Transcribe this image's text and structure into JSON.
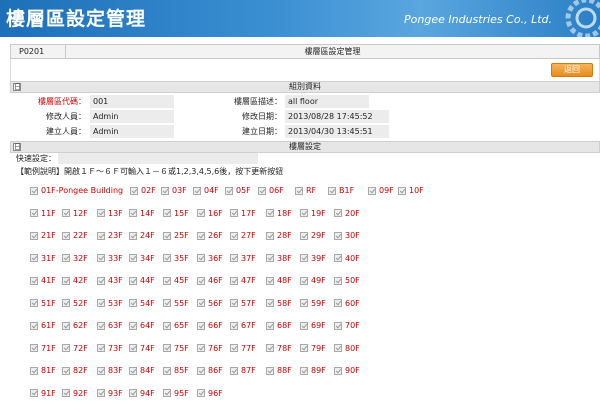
{
  "header": {
    "title": "樓層區設定管理",
    "company": "Pongee Industries Co., Ltd."
  },
  "program": {
    "id": "P0201",
    "name": "樓層區設定管理"
  },
  "back_button": "返回",
  "group_section": {
    "title": "組別資料",
    "toggle": "日",
    "fields": {
      "floor_code_label": "樓層區代碼：",
      "floor_code_value": "001",
      "floor_desc_label": "樓層區描述：",
      "floor_desc_value": "all floor",
      "modifier_label": "修改人員：",
      "modifier_value": "Admin",
      "modify_date_label": "修改日期：",
      "modify_date_value": "2013/08/28 17:45:52",
      "creator_label": "建立人員：",
      "creator_value": "Admin",
      "create_date_label": "建立日期：",
      "create_date_value": "2013/04/30 13:45:51"
    }
  },
  "floor_section": {
    "title": "樓層設定",
    "toggle": "日",
    "quick_label": "快速設定：",
    "example": "【範例說明】開啟１Ｆ～６Ｆ可輸入１－６或1,2,3,4,5,6後，按下更新按鈕",
    "rows": [
      [
        "01F-Pongee Building",
        "02F",
        "03F",
        "04F",
        "05F",
        "06F",
        "RF",
        "B1F",
        "09F",
        "10F"
      ],
      [
        "11F",
        "12F",
        "13F",
        "14F",
        "15F",
        "16F",
        "17F",
        "18F",
        "19F",
        "20F"
      ],
      [
        "21F",
        "22F",
        "23F",
        "24F",
        "25F",
        "26F",
        "27F",
        "28F",
        "29F",
        "30F"
      ],
      [
        "31F",
        "32F",
        "33F",
        "34F",
        "35F",
        "36F",
        "37F",
        "38F",
        "39F",
        "40F"
      ],
      [
        "41F",
        "42F",
        "43F",
        "44F",
        "45F",
        "46F",
        "47F",
        "48F",
        "49F",
        "50F"
      ],
      [
        "51F",
        "52F",
        "53F",
        "54F",
        "55F",
        "56F",
        "57F",
        "58F",
        "59F",
        "60F"
      ],
      [
        "61F",
        "62F",
        "63F",
        "64F",
        "65F",
        "66F",
        "67F",
        "68F",
        "69F",
        "70F"
      ],
      [
        "71F",
        "72F",
        "73F",
        "74F",
        "75F",
        "76F",
        "77F",
        "78F",
        "79F",
        "80F"
      ],
      [
        "81F",
        "82F",
        "83F",
        "84F",
        "85F",
        "86F",
        "87F",
        "88F",
        "89F",
        "90F"
      ],
      [
        "91F",
        "92F",
        "93F",
        "94F",
        "95F",
        "96F"
      ]
    ]
  }
}
